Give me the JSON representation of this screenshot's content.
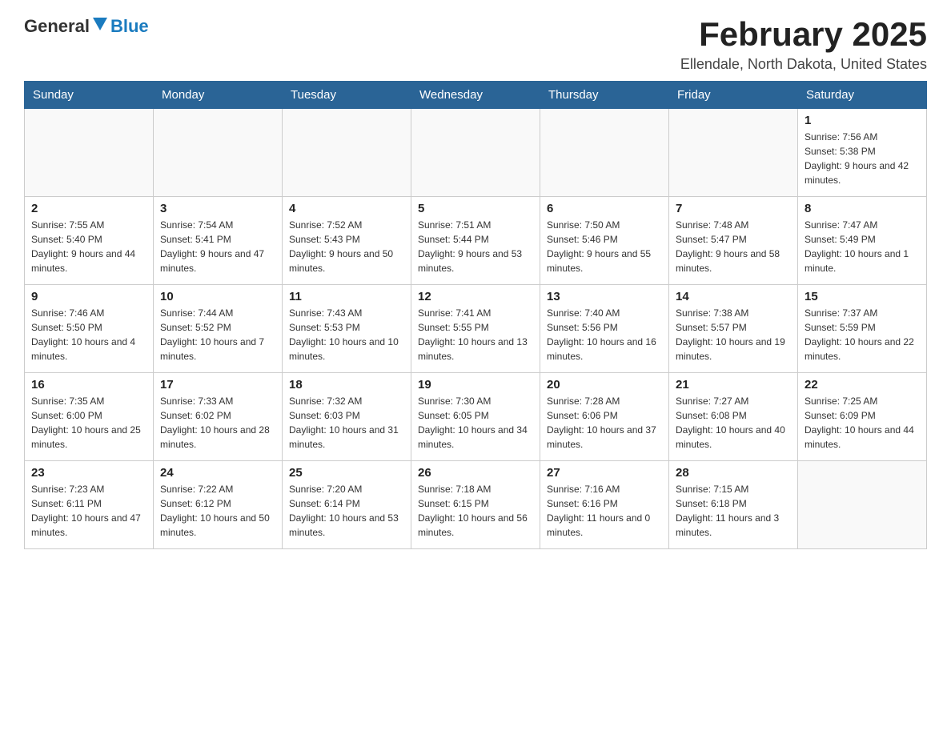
{
  "header": {
    "logo": {
      "general": "General",
      "blue": "Blue"
    },
    "title": "February 2025",
    "location": "Ellendale, North Dakota, United States"
  },
  "days_of_week": [
    "Sunday",
    "Monday",
    "Tuesday",
    "Wednesday",
    "Thursday",
    "Friday",
    "Saturday"
  ],
  "weeks": [
    {
      "days": [
        {
          "num": "",
          "info": ""
        },
        {
          "num": "",
          "info": ""
        },
        {
          "num": "",
          "info": ""
        },
        {
          "num": "",
          "info": ""
        },
        {
          "num": "",
          "info": ""
        },
        {
          "num": "",
          "info": ""
        },
        {
          "num": "1",
          "info": "Sunrise: 7:56 AM\nSunset: 5:38 PM\nDaylight: 9 hours and 42 minutes."
        }
      ]
    },
    {
      "days": [
        {
          "num": "2",
          "info": "Sunrise: 7:55 AM\nSunset: 5:40 PM\nDaylight: 9 hours and 44 minutes."
        },
        {
          "num": "3",
          "info": "Sunrise: 7:54 AM\nSunset: 5:41 PM\nDaylight: 9 hours and 47 minutes."
        },
        {
          "num": "4",
          "info": "Sunrise: 7:52 AM\nSunset: 5:43 PM\nDaylight: 9 hours and 50 minutes."
        },
        {
          "num": "5",
          "info": "Sunrise: 7:51 AM\nSunset: 5:44 PM\nDaylight: 9 hours and 53 minutes."
        },
        {
          "num": "6",
          "info": "Sunrise: 7:50 AM\nSunset: 5:46 PM\nDaylight: 9 hours and 55 minutes."
        },
        {
          "num": "7",
          "info": "Sunrise: 7:48 AM\nSunset: 5:47 PM\nDaylight: 9 hours and 58 minutes."
        },
        {
          "num": "8",
          "info": "Sunrise: 7:47 AM\nSunset: 5:49 PM\nDaylight: 10 hours and 1 minute."
        }
      ]
    },
    {
      "days": [
        {
          "num": "9",
          "info": "Sunrise: 7:46 AM\nSunset: 5:50 PM\nDaylight: 10 hours and 4 minutes."
        },
        {
          "num": "10",
          "info": "Sunrise: 7:44 AM\nSunset: 5:52 PM\nDaylight: 10 hours and 7 minutes."
        },
        {
          "num": "11",
          "info": "Sunrise: 7:43 AM\nSunset: 5:53 PM\nDaylight: 10 hours and 10 minutes."
        },
        {
          "num": "12",
          "info": "Sunrise: 7:41 AM\nSunset: 5:55 PM\nDaylight: 10 hours and 13 minutes."
        },
        {
          "num": "13",
          "info": "Sunrise: 7:40 AM\nSunset: 5:56 PM\nDaylight: 10 hours and 16 minutes."
        },
        {
          "num": "14",
          "info": "Sunrise: 7:38 AM\nSunset: 5:57 PM\nDaylight: 10 hours and 19 minutes."
        },
        {
          "num": "15",
          "info": "Sunrise: 7:37 AM\nSunset: 5:59 PM\nDaylight: 10 hours and 22 minutes."
        }
      ]
    },
    {
      "days": [
        {
          "num": "16",
          "info": "Sunrise: 7:35 AM\nSunset: 6:00 PM\nDaylight: 10 hours and 25 minutes."
        },
        {
          "num": "17",
          "info": "Sunrise: 7:33 AM\nSunset: 6:02 PM\nDaylight: 10 hours and 28 minutes."
        },
        {
          "num": "18",
          "info": "Sunrise: 7:32 AM\nSunset: 6:03 PM\nDaylight: 10 hours and 31 minutes."
        },
        {
          "num": "19",
          "info": "Sunrise: 7:30 AM\nSunset: 6:05 PM\nDaylight: 10 hours and 34 minutes."
        },
        {
          "num": "20",
          "info": "Sunrise: 7:28 AM\nSunset: 6:06 PM\nDaylight: 10 hours and 37 minutes."
        },
        {
          "num": "21",
          "info": "Sunrise: 7:27 AM\nSunset: 6:08 PM\nDaylight: 10 hours and 40 minutes."
        },
        {
          "num": "22",
          "info": "Sunrise: 7:25 AM\nSunset: 6:09 PM\nDaylight: 10 hours and 44 minutes."
        }
      ]
    },
    {
      "days": [
        {
          "num": "23",
          "info": "Sunrise: 7:23 AM\nSunset: 6:11 PM\nDaylight: 10 hours and 47 minutes."
        },
        {
          "num": "24",
          "info": "Sunrise: 7:22 AM\nSunset: 6:12 PM\nDaylight: 10 hours and 50 minutes."
        },
        {
          "num": "25",
          "info": "Sunrise: 7:20 AM\nSunset: 6:14 PM\nDaylight: 10 hours and 53 minutes."
        },
        {
          "num": "26",
          "info": "Sunrise: 7:18 AM\nSunset: 6:15 PM\nDaylight: 10 hours and 56 minutes."
        },
        {
          "num": "27",
          "info": "Sunrise: 7:16 AM\nSunset: 6:16 PM\nDaylight: 11 hours and 0 minutes."
        },
        {
          "num": "28",
          "info": "Sunrise: 7:15 AM\nSunset: 6:18 PM\nDaylight: 11 hours and 3 minutes."
        },
        {
          "num": "",
          "info": ""
        }
      ]
    }
  ]
}
